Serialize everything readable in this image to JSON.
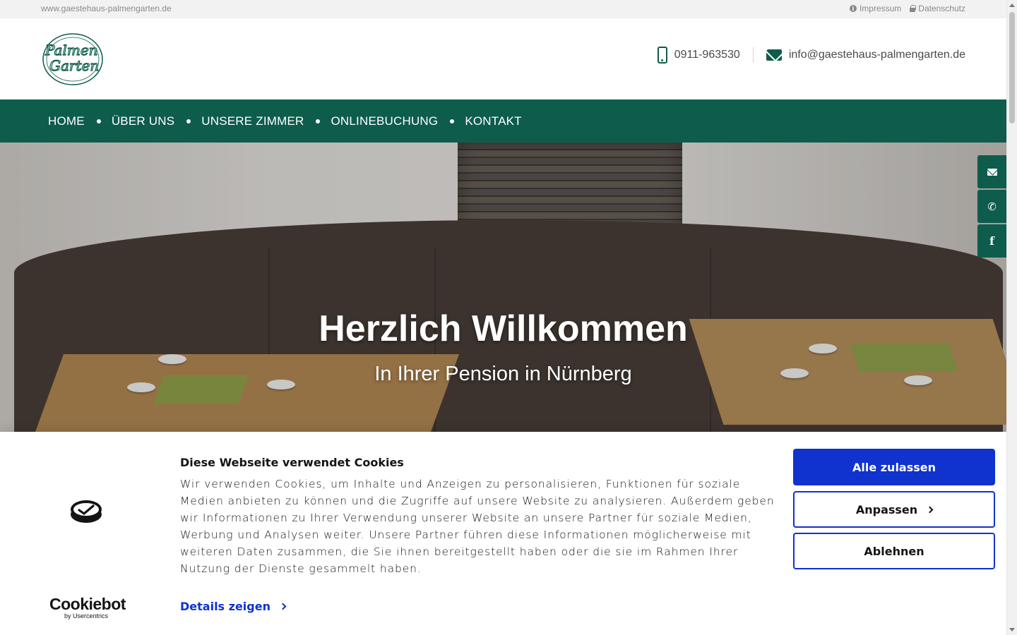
{
  "topbar": {
    "domain": "www.gaestehaus-palmengarten.de",
    "impressum": "Impressum",
    "datenschutz": "Datenschutz"
  },
  "header": {
    "logo_line1": "Palmen",
    "logo_line2": "Garten",
    "phone": "0911-963530",
    "email": "info@gaestehaus-palmengarten.de"
  },
  "nav": {
    "items": [
      "HOME",
      "ÜBER UNS",
      "UNSERE ZIMMER",
      "ONLINEBUCHUNG",
      "KONTAKT"
    ]
  },
  "hero": {
    "title": "Herzlich Willkommen",
    "subtitle": "In Ihrer Pension in Nürnberg"
  },
  "side_buttons": {
    "email_icon": "envelope-icon",
    "phone_icon": "phone-icon",
    "facebook_icon": "facebook-icon",
    "facebook_glyph": "f",
    "phone_glyph": "✆"
  },
  "cookie": {
    "title": "Diese Webseite verwendet Cookies",
    "text": "Wir verwenden Cookies, um Inhalte und Anzeigen zu personalisieren, Funktionen für soziale Medien anbieten zu können und die Zugriffe auf unsere Website zu analysieren. Außerdem geben wir Informationen zu Ihrer Verwendung unserer Website an unsere Partner für soziale Medien, Werbung und Analysen weiter. Unsere Partner führen diese Informationen möglicherweise mit weiteren Daten zusammen, die Sie ihnen bereitgestellt haben oder die sie im Rahmen Ihrer Nutzung der Dienste gesammelt haben.",
    "details_link": "Details zeigen",
    "btn_allow_all": "Alle zulassen",
    "btn_customize": "Anpassen",
    "btn_decline": "Ablehnen",
    "brand": "Cookiebot",
    "brand_sub": "by Usercentrics"
  },
  "colors": {
    "brand_green": "#0e5c4c",
    "cookie_blue": "#1032cf"
  }
}
